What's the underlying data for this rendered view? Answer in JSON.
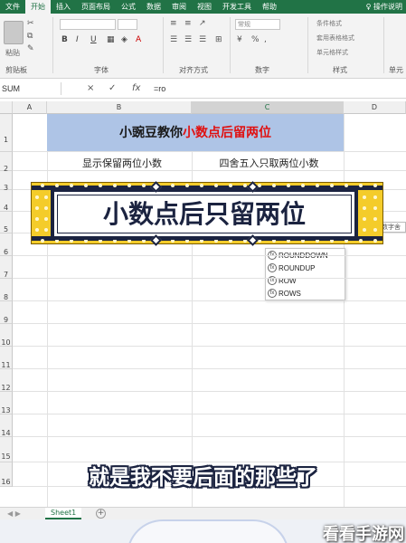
{
  "ribbon": {
    "tabs": [
      "文件",
      "开始",
      "插入",
      "页面布局",
      "公式",
      "数据",
      "审阅",
      "视图",
      "开发工具",
      "帮助"
    ],
    "active_tab": "开始",
    "search_hint": "操作说明",
    "groups": {
      "clipboard": "剪贴板",
      "font": "字体",
      "alignment": "对齐方式",
      "number": "数字",
      "styles": "样式",
      "cells": "单元"
    },
    "paste_label": "粘贴",
    "styles_items": [
      "条件格式",
      "套用表格格式",
      "单元格样式"
    ],
    "number_format": "常规"
  },
  "formula_bar": {
    "name_box": "SUM",
    "cancel_icon": "×",
    "enter_icon": "✓",
    "fx_label": "fx",
    "formula": "=ro"
  },
  "grid": {
    "columns": [
      "A",
      "B",
      "C",
      "D"
    ],
    "selected_column": "C",
    "rows": [
      "1",
      "2",
      "3",
      "4",
      "5",
      "6",
      "7",
      "8",
      "9",
      "10",
      "11",
      "12",
      "13",
      "14",
      "15",
      "16"
    ]
  },
  "cells": {
    "title_prefix": "小豌豆教你",
    "title_highlight": "小数点后留两位",
    "b2": "显示保留两位小数",
    "c2": "四舍五入只取两位小数"
  },
  "autocomplete": {
    "items": [
      "ROUNDDOWN",
      "ROUNDUP",
      "ROW",
      "ROWS"
    ],
    "tooltip": "数字舍"
  },
  "overlay": {
    "banner_text": "小数点后只留两位",
    "subtitle": "就是我不要后面的那些了"
  },
  "sheets": {
    "tabs": [
      "Sheet1"
    ],
    "add_icon": "+"
  },
  "watermark": "看看手游网",
  "colors": {
    "excel_green": "#217346",
    "title_fill": "#aec4e6",
    "highlight_red": "#e01010",
    "banner_yellow": "#f4cc2a",
    "banner_navy": "#1b2340"
  }
}
